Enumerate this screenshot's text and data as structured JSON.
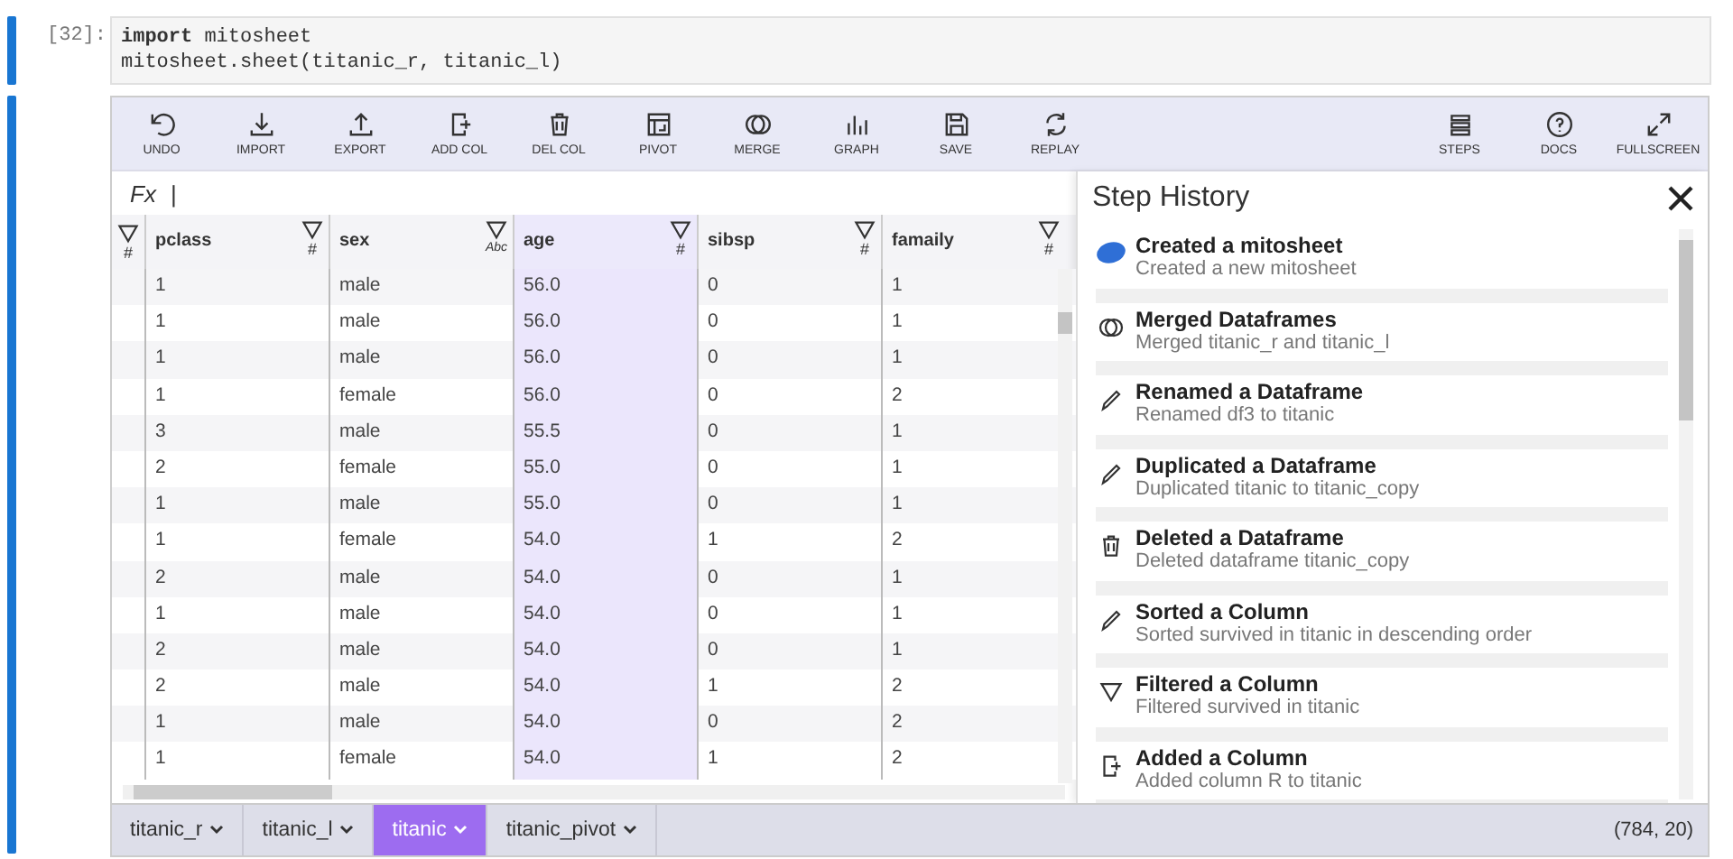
{
  "cell": {
    "prompt": "[32]:",
    "code": [
      "**import** mitosheet",
      "mitosheet.sheet(titanic_r, titanic_l)"
    ]
  },
  "toolbar": {
    "left": [
      {
        "kind": "undo",
        "label": "UNDO"
      },
      {
        "kind": "import",
        "label": "IMPORT"
      },
      {
        "kind": "export",
        "label": "EXPORT"
      },
      {
        "kind": "addcol",
        "label": "ADD COL"
      },
      {
        "kind": "delcol",
        "label": "DEL COL"
      },
      {
        "kind": "pivot",
        "label": "PIVOT"
      },
      {
        "kind": "merge",
        "label": "MERGE"
      },
      {
        "kind": "graph",
        "label": "GRAPH"
      },
      {
        "kind": "save",
        "label": "SAVE"
      },
      {
        "kind": "replay",
        "label": "REPLAY"
      }
    ],
    "right": [
      {
        "kind": "steps",
        "label": "STEPS"
      },
      {
        "kind": "docs",
        "label": "DOCS"
      },
      {
        "kind": "fullscreen",
        "label": "FULLSCREEN"
      }
    ]
  },
  "formula_bar": {
    "label": "Fx",
    "value": "|"
  },
  "grid": {
    "index_type": "#",
    "columns": [
      {
        "name": "pclass",
        "type": "#",
        "selected": false
      },
      {
        "name": "sex",
        "type": "Abc",
        "selected": false
      },
      {
        "name": "age",
        "type": "#",
        "selected": true
      },
      {
        "name": "sibsp",
        "type": "#",
        "selected": false
      },
      {
        "name": "famaily",
        "type": "#",
        "selected": false
      }
    ],
    "rows": [
      [
        "1",
        "male",
        "56.0",
        "0",
        "1"
      ],
      [
        "1",
        "male",
        "56.0",
        "0",
        "1"
      ],
      [
        "1",
        "male",
        "56.0",
        "0",
        "1"
      ],
      [
        "1",
        "female",
        "56.0",
        "0",
        "2"
      ],
      [
        "3",
        "male",
        "55.5",
        "0",
        "1"
      ],
      [
        "2",
        "female",
        "55.0",
        "0",
        "1"
      ],
      [
        "1",
        "male",
        "55.0",
        "0",
        "1"
      ],
      [
        "1",
        "female",
        "54.0",
        "1",
        "2"
      ],
      [
        "2",
        "male",
        "54.0",
        "0",
        "1"
      ],
      [
        "1",
        "male",
        "54.0",
        "0",
        "1"
      ],
      [
        "2",
        "male",
        "54.0",
        "0",
        "1"
      ],
      [
        "2",
        "male",
        "54.0",
        "1",
        "2"
      ],
      [
        "1",
        "male",
        "54.0",
        "0",
        "2"
      ],
      [
        "1",
        "female",
        "54.0",
        "1",
        "2"
      ]
    ]
  },
  "step_history": {
    "title": "Step History",
    "steps": [
      {
        "kind": "mitosheet",
        "title": "Created a mitosheet",
        "description": "Created a new mitosheet"
      },
      {
        "kind": "merge",
        "title": "Merged Dataframes",
        "description": "Merged titanic_r and titanic_l"
      },
      {
        "kind": "edit",
        "title": "Renamed a Dataframe",
        "description": "Renamed df3 to titanic"
      },
      {
        "kind": "edit",
        "title": "Duplicated a Dataframe",
        "description": "Duplicated titanic to titanic_copy"
      },
      {
        "kind": "delete",
        "title": "Deleted a Dataframe",
        "description": "Deleted dataframe titanic_copy"
      },
      {
        "kind": "edit",
        "title": "Sorted a Column",
        "description": "Sorted survived in titanic in descending order"
      },
      {
        "kind": "filter",
        "title": "Filtered a Column",
        "description": "Filtered survived in titanic"
      },
      {
        "kind": "addcol",
        "title": "Added a Column",
        "description": "Added column R to titanic"
      }
    ]
  },
  "sheet_tabs": [
    {
      "label": "titanic_r",
      "selected": false
    },
    {
      "label": "titanic_l",
      "selected": false
    },
    {
      "label": "titanic",
      "selected": true
    },
    {
      "label": "titanic_pivot",
      "selected": false
    }
  ],
  "status": "(784, 20)"
}
